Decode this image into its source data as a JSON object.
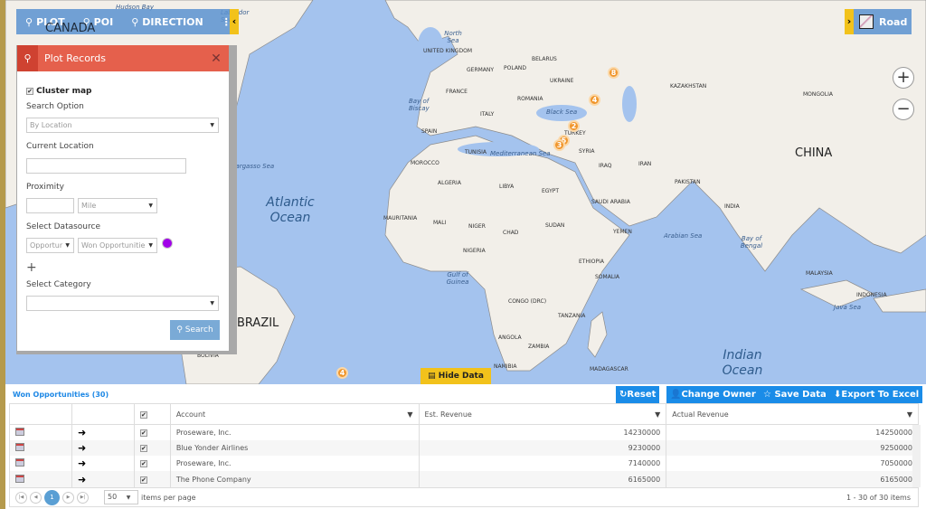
{
  "toolbar": {
    "plot": "PLOT",
    "poi": "POI",
    "direction": "DIRECTION",
    "more": "⋮",
    "collapse": "‹"
  },
  "map": {
    "style_label": "Road",
    "expand": "›",
    "zoom_in": "+",
    "zoom_out": "−",
    "countries": {
      "canada": "CANADA",
      "china": "CHINA",
      "brazil": "BRAZIL",
      "uk": "UNITED KINGDOM",
      "belarus": "BELARUS",
      "poland": "POLAND",
      "germany": "GERMANY",
      "france": "FRANCE",
      "ukraine": "UKRAINE",
      "romania": "ROMANIA",
      "italy": "ITALY",
      "spain": "SPAIN",
      "turkey": "TURKEY",
      "syria": "SYRIA",
      "iraq": "IRAQ",
      "iran": "IRAN",
      "tunisia": "TUNISIA",
      "morocco": "MOROCCO",
      "algeria": "ALGERIA",
      "libya": "LIBYA",
      "egypt": "EGYPT",
      "saudi": "SAUDI ARABIA",
      "kazakhstan": "KAZAKHSTAN",
      "mongolia": "MONGOLIA",
      "pakistan": "PAKISTAN",
      "india": "INDIA",
      "yemen": "YEMEN",
      "sudan": "SUDAN",
      "chad": "CHAD",
      "niger": "NIGER",
      "mali": "MALI",
      "mauritania": "MAURITANIA",
      "nigeria": "NIGERIA",
      "ethiopia": "ETHIOPIA",
      "somalia": "SOMALIA",
      "congo": "CONGO (DRC)",
      "tanzania": "TANZANIA",
      "angola": "ANGOLA",
      "zambia": "ZAMBIA",
      "namibia": "NAMIBIA",
      "madagascar": "MADAGASCAR",
      "bolivia": "BOLIVIA",
      "malaysia": "MALAYSIA",
      "indonesia": "INDONESIA"
    },
    "seas": {
      "hudson": "Hudson Bay",
      "labrador": "Labrador Sea",
      "north": "North Sea",
      "biscay": "Bay of Biscay",
      "black": "Black Sea",
      "med": "Mediterranean Sea",
      "arabian": "Arabian Sea",
      "bengal": "Bay of Bengal",
      "guinea": "Gulf of Guinea",
      "java": "Java Sea",
      "sargasso": "Sargasso Sea",
      "atlantic": "Atlantic Ocean",
      "indian": "Indian Ocean"
    },
    "markers": [
      "8",
      "4",
      "2",
      "5",
      "3",
      "4"
    ],
    "hide_data": "Hide Data"
  },
  "panel": {
    "title": "Plot Records",
    "close": "✕",
    "cluster_label": "Cluster map",
    "cluster_checked": true,
    "search_option_label": "Search Option",
    "search_option_value": "By Location",
    "current_location_label": "Current Location",
    "current_location_value": "",
    "proximity_label": "Proximity",
    "proximity_value": "",
    "proximity_unit": "Mile",
    "datasource_label": "Select Datasource",
    "datasource_entity": "Opportur",
    "datasource_view": "Won Opportunitie",
    "pin_color": "#a100e8",
    "add": "+",
    "category_label": "Select Category",
    "category_value": "",
    "search_button": "Search"
  },
  "grid": {
    "title": "Won Opportunities (30)",
    "actions": {
      "reset": "Reset",
      "change_owner": "Change Owner",
      "save": "Save Data",
      "export": "Export To Excel"
    },
    "columns": [
      "Account",
      "Est. Revenue",
      "Actual Revenue"
    ],
    "rows": [
      {
        "account": "Proseware, Inc.",
        "est": "14230000",
        "actual": "14250000"
      },
      {
        "account": "Blue Yonder Airlines",
        "est": "9230000",
        "actual": "9250000"
      },
      {
        "account": "Proseware, Inc.",
        "est": "7140000",
        "actual": "7050000"
      },
      {
        "account": "The Phone Company",
        "est": "6165000",
        "actual": "6165000"
      }
    ],
    "page_size": "50",
    "items_per_page": "items per page",
    "current_page": "1",
    "summary": "1 - 30 of 30 items"
  }
}
